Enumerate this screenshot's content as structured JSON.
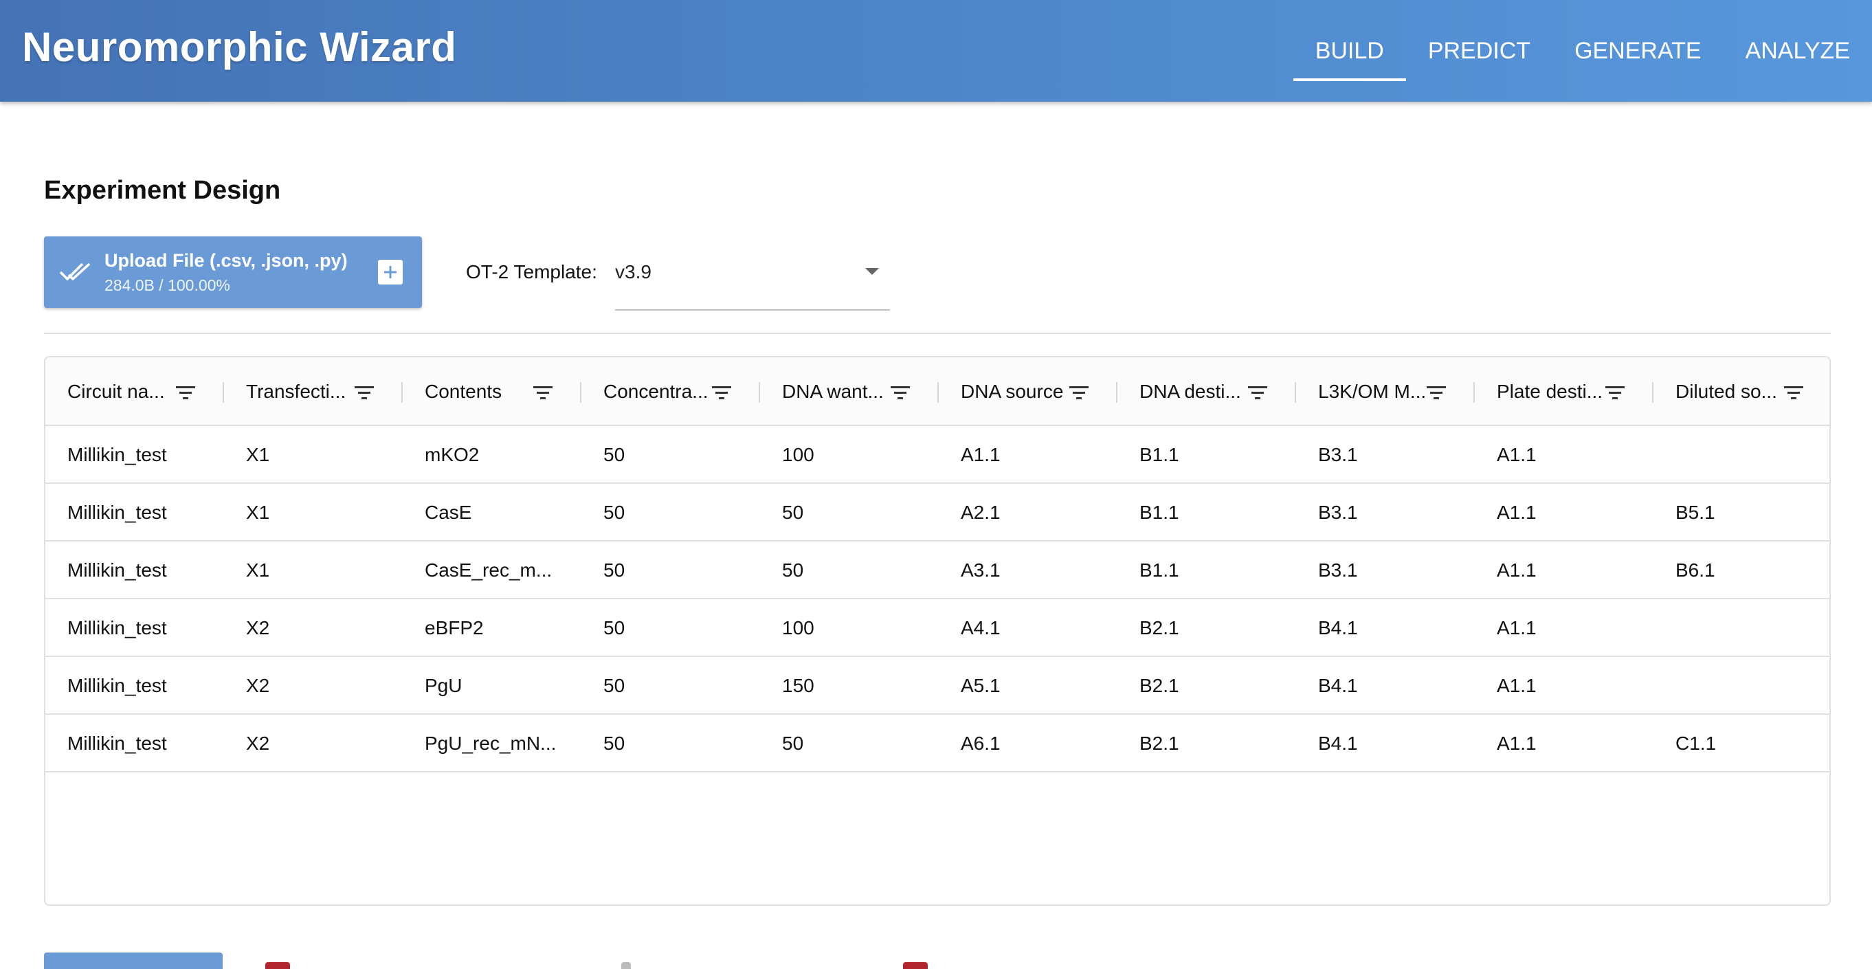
{
  "header": {
    "title": "Neuromorphic Wizard",
    "tabs": [
      {
        "label": "BUILD",
        "active": true
      },
      {
        "label": "PREDICT",
        "active": false
      },
      {
        "label": "GENERATE",
        "active": false
      },
      {
        "label": "ANALYZE",
        "active": false
      }
    ]
  },
  "section": {
    "title": "Experiment Design"
  },
  "upload": {
    "label": "Upload File (.csv, .json, .py)",
    "status": "284.0B / 100.00%"
  },
  "template": {
    "label": "OT-2 Template:",
    "value": "v3.9"
  },
  "grid": {
    "columns": [
      "Circuit na...",
      "Transfecti...",
      "Contents",
      "Concentra...",
      "DNA want...",
      "DNA source",
      "DNA desti...",
      "L3K/OM M...",
      "Plate desti...",
      "Diluted so..."
    ],
    "rows": [
      [
        "Millikin_test",
        "X1",
        "mKO2",
        "50",
        "100",
        "A1.1",
        "B1.1",
        "B3.1",
        "A1.1",
        ""
      ],
      [
        "Millikin_test",
        "X1",
        "CasE",
        "50",
        "50",
        "A2.1",
        "B1.1",
        "B3.1",
        "A1.1",
        "B5.1"
      ],
      [
        "Millikin_test",
        "X1",
        "CasE_rec_m...",
        "50",
        "50",
        "A3.1",
        "B1.1",
        "B3.1",
        "A1.1",
        "B6.1"
      ],
      [
        "Millikin_test",
        "X2",
        "eBFP2",
        "50",
        "100",
        "A4.1",
        "B2.1",
        "B4.1",
        "A1.1",
        ""
      ],
      [
        "Millikin_test",
        "X2",
        "PgU",
        "50",
        "150",
        "A5.1",
        "B2.1",
        "B4.1",
        "A1.1",
        ""
      ],
      [
        "Millikin_test",
        "X2",
        "PgU_rec_mN...",
        "50",
        "50",
        "A6.1",
        "B2.1",
        "B4.1",
        "A1.1",
        "C1.1"
      ]
    ]
  },
  "colors": {
    "header_start": "#4473b6",
    "header_end": "#5897dc",
    "button": "#6b9bd6",
    "bottom_icon_red": "#b3262f"
  }
}
